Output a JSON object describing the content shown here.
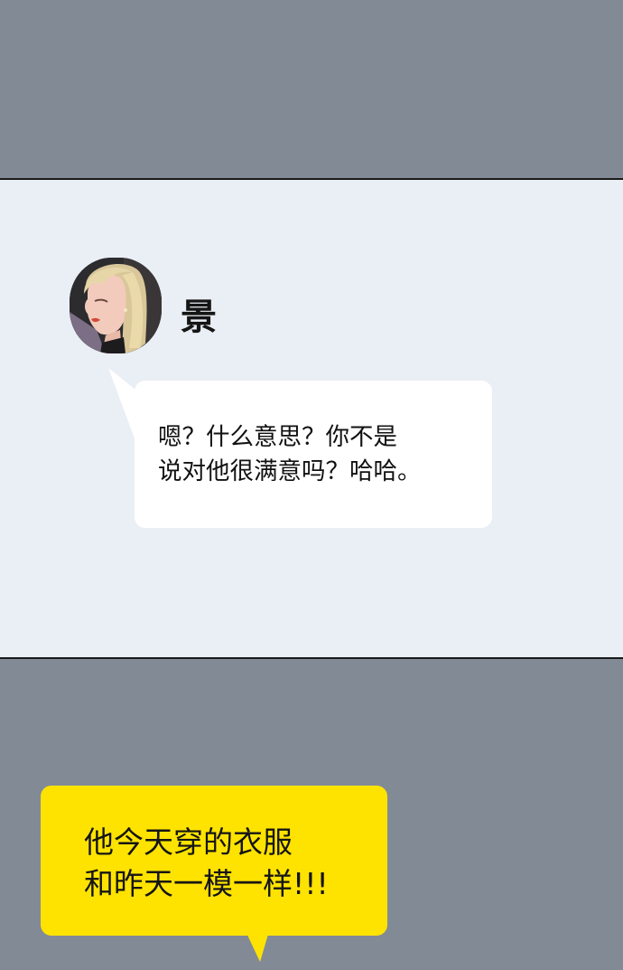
{
  "sender": {
    "name": "景"
  },
  "message": {
    "lines": [
      "嗯？什么意思？你不是",
      "说对他很满意吗？哈哈。"
    ]
  },
  "narration": {
    "lines": [
      "他今天穿的衣服",
      "和昨天一模一样!!!"
    ]
  },
  "colors": {
    "background_gray": "#828a96",
    "chat_panel": "#eaeef5",
    "bubble": "#ffffff",
    "narration_yellow": "#ffe300"
  },
  "icons": {
    "avatar": "woman-portrait-avatar"
  }
}
